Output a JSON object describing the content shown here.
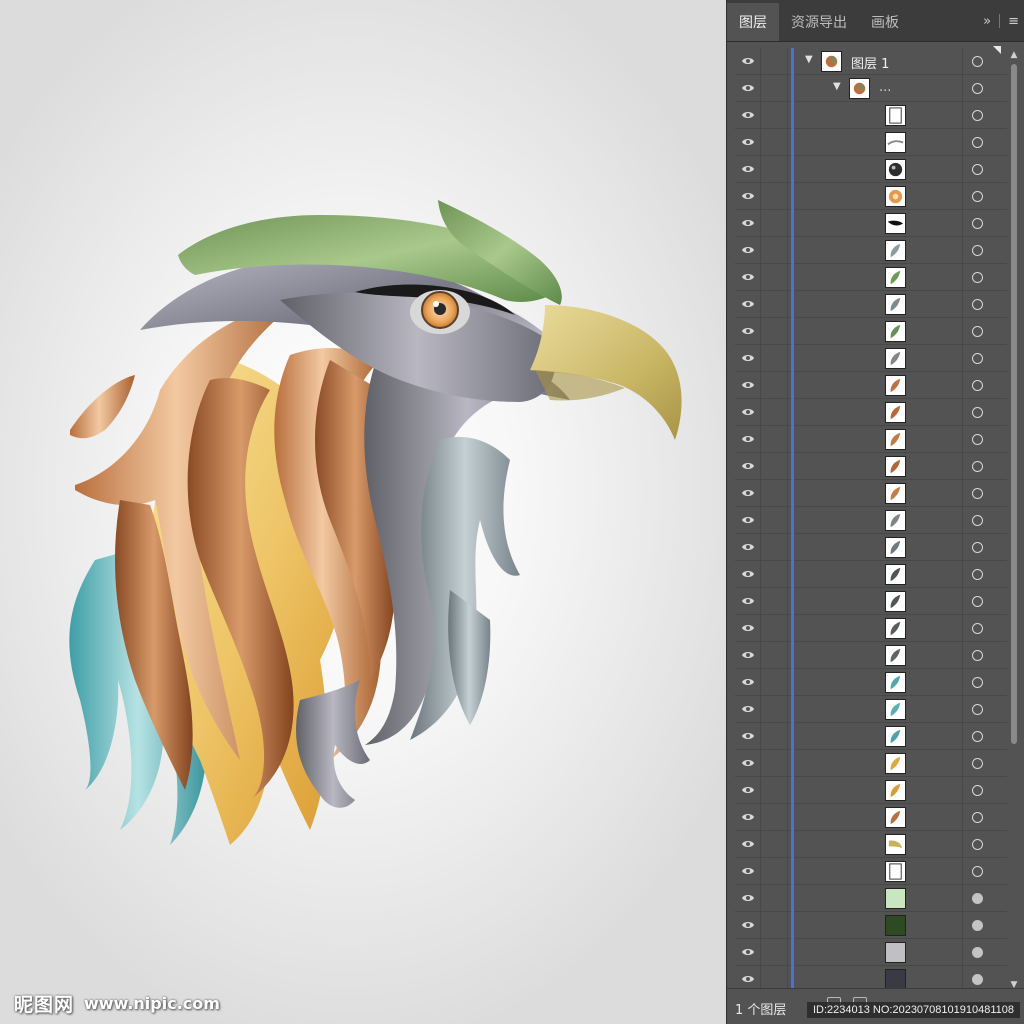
{
  "panel": {
    "tabs": [
      {
        "label": "图层",
        "active": true
      },
      {
        "label": "资源导出",
        "active": false
      },
      {
        "label": "画板",
        "active": false
      }
    ],
    "expand_icon": "double-chevron-right-icon",
    "menu_icon": "hamburger-menu-icon",
    "layer_count": "1 个图层"
  },
  "layers": {
    "root": {
      "name": "图层 1",
      "expanded": true
    },
    "group": {
      "name": "...",
      "expanded": true
    },
    "items": [
      {
        "thumb": "white-rect",
        "color": "#ffffff"
      },
      {
        "thumb": "gray-swoosh",
        "color": "#8a8a8a"
      },
      {
        "thumb": "dark-eye",
        "color": "#2e2e2e"
      },
      {
        "thumb": "orange-iris",
        "color": "#e39a4b"
      },
      {
        "thumb": "black-brow",
        "color": "#111111"
      },
      {
        "thumb": "gray-feather",
        "color": "#8f9aa0"
      },
      {
        "thumb": "green-feather",
        "color": "#6f9a55"
      },
      {
        "thumb": "gray-feather",
        "color": "#7d8a90"
      },
      {
        "thumb": "green-feather",
        "color": "#6b8f5a"
      },
      {
        "thumb": "gray-feather",
        "color": "#868686"
      },
      {
        "thumb": "brown-feather",
        "color": "#c0713f"
      },
      {
        "thumb": "brown-feather",
        "color": "#b8683a"
      },
      {
        "thumb": "brown-feather",
        "color": "#c27a45"
      },
      {
        "thumb": "brown-feather",
        "color": "#b56638"
      },
      {
        "thumb": "brown-feather",
        "color": "#c47c48"
      },
      {
        "thumb": "gray-feather",
        "color": "#7c858a"
      },
      {
        "thumb": "gray-feather",
        "color": "#6f7a80"
      },
      {
        "thumb": "dark-feather",
        "color": "#4d5559"
      },
      {
        "thumb": "dark-feather",
        "color": "#50575b"
      },
      {
        "thumb": "dark-feather",
        "color": "#565d61"
      },
      {
        "thumb": "dark-feather",
        "color": "#5d6469"
      },
      {
        "thumb": "teal-feather",
        "color": "#4fa9b0"
      },
      {
        "thumb": "teal-feather",
        "color": "#58b0b6"
      },
      {
        "thumb": "teal-feather",
        "color": "#4aa3aa"
      },
      {
        "thumb": "yellow-feather",
        "color": "#e2a83a"
      },
      {
        "thumb": "yellow-feather",
        "color": "#d99c2f"
      },
      {
        "thumb": "brown-feather",
        "color": "#b9703e"
      },
      {
        "thumb": "beak",
        "color": "#c9b25c"
      },
      {
        "thumb": "white-rect",
        "color": "#ffffff"
      },
      {
        "thumb": "solid",
        "color": "#c9e6c0"
      },
      {
        "thumb": "solid",
        "color": "#2e4a22"
      },
      {
        "thumb": "solid",
        "color": "#bfbfc4"
      },
      {
        "thumb": "solid",
        "color": "#3a3a44"
      }
    ]
  },
  "watermark": {
    "logo": "昵图网",
    "url": "www.nipic.com"
  },
  "id_overlay": "ID:2234013 NO:20230708101910481108"
}
